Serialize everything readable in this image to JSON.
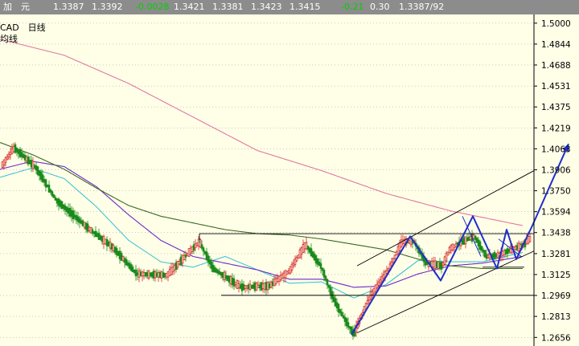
{
  "quote": {
    "name": "加　元",
    "last": "1.3387",
    "ask": "1.3392",
    "change": "-0.0028",
    "open": "1.3421",
    "low": "1.3381",
    "high": "1.3423",
    "close": "1.3415",
    "change_pct": "-0.21",
    "amplitude": "0.30",
    "bid_ask": "1.3387/92"
  },
  "chart_header": {
    "symbol_period": "CAD　日线",
    "indicator": "均线"
  },
  "colors": {
    "background": "#ffffe8",
    "axis": "#000000",
    "up_candle": "#d42a2a",
    "down_candle": "#1a8a1a",
    "ma_cyan": "#45c3d4",
    "ma_purple": "#6a2bc7",
    "ma_olive": "#3b6a23",
    "ma_pink": "#e0789f",
    "pattern_blue": "#1f2fc9",
    "trendline": "#000000"
  },
  "chart_data": {
    "type": "candlestick",
    "y_ticks": [
      1.5,
      1.4844,
      1.4688,
      1.4531,
      1.4375,
      1.4219,
      1.4063,
      1.3906,
      1.375,
      1.3594,
      1.3438,
      1.3281,
      1.3125,
      1.2969,
      1.2813,
      1.2656
    ],
    "ylim": [
      1.2592,
      1.5065
    ],
    "n_bars": 330,
    "candle_anchors": [
      [
        0,
        1.392
      ],
      [
        18,
        1.407
      ],
      [
        45,
        1.392
      ],
      [
        70,
        1.368
      ],
      [
        110,
        1.347
      ],
      [
        140,
        1.333
      ],
      [
        170,
        1.313
      ],
      [
        208,
        1.312
      ],
      [
        248,
        1.337
      ],
      [
        265,
        1.317
      ],
      [
        300,
        1.303
      ],
      [
        335,
        1.304
      ],
      [
        360,
        1.315
      ],
      [
        380,
        1.335
      ],
      [
        400,
        1.318
      ],
      [
        415,
        1.294
      ],
      [
        425,
        1.283
      ],
      [
        440,
        1.268
      ],
      [
        460,
        1.296
      ],
      [
        485,
        1.318
      ],
      [
        500,
        1.337
      ],
      [
        515,
        1.337
      ],
      [
        530,
        1.321
      ],
      [
        550,
        1.319
      ],
      [
        560,
        1.332
      ],
      [
        575,
        1.337
      ],
      [
        590,
        1.341
      ],
      [
        605,
        1.326
      ],
      [
        620,
        1.327
      ],
      [
        635,
        1.331
      ],
      [
        650,
        1.334
      ],
      [
        658,
        1.339
      ]
    ],
    "moving_averages": [
      {
        "color_key": "ma_cyan",
        "points": [
          [
            0,
            1.385
          ],
          [
            40,
            1.392
          ],
          [
            80,
            1.384
          ],
          [
            120,
            1.363
          ],
          [
            160,
            1.338
          ],
          [
            200,
            1.322
          ],
          [
            240,
            1.318
          ],
          [
            280,
            1.326
          ],
          [
            320,
            1.316
          ],
          [
            360,
            1.306
          ],
          [
            400,
            1.307
          ],
          [
            440,
            1.295
          ],
          [
            480,
            1.305
          ],
          [
            520,
            1.323
          ],
          [
            560,
            1.322
          ],
          [
            600,
            1.322
          ],
          [
            650,
            1.329
          ]
        ]
      },
      {
        "color_key": "ma_purple",
        "points": [
          [
            0,
            1.391
          ],
          [
            40,
            1.397
          ],
          [
            80,
            1.393
          ],
          [
            120,
            1.378
          ],
          [
            160,
            1.357
          ],
          [
            200,
            1.338
          ],
          [
            240,
            1.326
          ],
          [
            280,
            1.321
          ],
          [
            320,
            1.316
          ],
          [
            360,
            1.309
          ],
          [
            400,
            1.309
          ],
          [
            440,
            1.303
          ],
          [
            480,
            1.304
          ],
          [
            520,
            1.313
          ],
          [
            560,
            1.319
          ],
          [
            600,
            1.321
          ],
          [
            650,
            1.326
          ]
        ]
      },
      {
        "color_key": "ma_olive",
        "points": [
          [
            0,
            1.411
          ],
          [
            40,
            1.402
          ],
          [
            80,
            1.391
          ],
          [
            120,
            1.377
          ],
          [
            160,
            1.364
          ],
          [
            200,
            1.356
          ],
          [
            240,
            1.351
          ],
          [
            280,
            1.346
          ],
          [
            320,
            1.343
          ],
          [
            360,
            1.342
          ],
          [
            400,
            1.339
          ],
          [
            440,
            1.335
          ],
          [
            480,
            1.331
          ],
          [
            520,
            1.324
          ],
          [
            560,
            1.319
          ],
          [
            600,
            1.317
          ],
          [
            650,
            1.317
          ]
        ]
      },
      {
        "color_key": "ma_pink",
        "points": [
          [
            0,
            1.488
          ],
          [
            80,
            1.476
          ],
          [
            160,
            1.455
          ],
          [
            240,
            1.43
          ],
          [
            320,
            1.405
          ],
          [
            400,
            1.39
          ],
          [
            480,
            1.373
          ],
          [
            560,
            1.36
          ],
          [
            650,
            1.349
          ]
        ]
      }
    ],
    "channel": {
      "upper": [
        [
          444,
          1.319
        ],
        [
          664,
          1.39
        ]
      ],
      "lower": [
        [
          444,
          1.269
        ],
        [
          664,
          1.33
        ]
      ]
    },
    "rectangle": {
      "x0": 248,
      "x1": 664,
      "top": 1.343,
      "bottom": 1.297
    },
    "support_lines": [
      [
        [
          275,
          1.297
        ],
        [
          664,
          1.297
        ]
      ],
      [
        [
          600,
          1.318
        ],
        [
          652,
          1.318
        ]
      ]
    ],
    "zigzag": [
      [
        437,
        1.2675
      ],
      [
        510,
        1.341
      ],
      [
        548,
        1.308
      ],
      [
        588,
        1.356
      ],
      [
        618,
        1.317
      ],
      [
        630,
        1.346
      ],
      [
        642,
        1.324
      ],
      [
        662,
        1.349
      ],
      [
        707,
        1.41
      ]
    ],
    "arrow_tip": [
      707,
      1.41
    ],
    "wave_lines": [
      [
        [
          575,
          1.356
        ],
        [
          598,
          1.326
        ]
      ],
      [
        [
          620,
          1.339
        ],
        [
          648,
          1.326
        ]
      ]
    ]
  }
}
